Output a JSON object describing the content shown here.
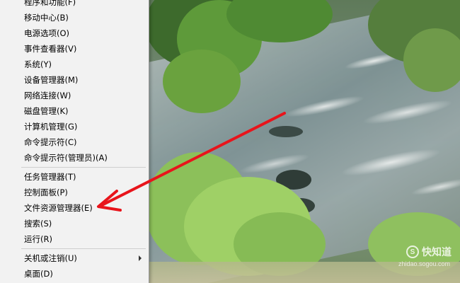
{
  "menu": {
    "items": [
      {
        "label": "程序和功能(F)"
      },
      {
        "label": "移动中心(B)"
      },
      {
        "label": "电源选项(O)"
      },
      {
        "label": "事件查看器(V)"
      },
      {
        "label": "系统(Y)"
      },
      {
        "label": "设备管理器(M)"
      },
      {
        "label": "网络连接(W)"
      },
      {
        "label": "磁盘管理(K)"
      },
      {
        "label": "计算机管理(G)"
      },
      {
        "label": "命令提示符(C)"
      },
      {
        "label": "命令提示符(管理员)(A)"
      },
      {
        "label": "任务管理器(T)"
      },
      {
        "label": "控制面板(P)"
      },
      {
        "label": "文件资源管理器(E)"
      },
      {
        "label": "搜索(S)"
      },
      {
        "label": "运行(R)"
      },
      {
        "label": "关机或注销(U)"
      },
      {
        "label": "桌面(D)"
      }
    ]
  },
  "watermark": {
    "brand": "快知道",
    "site": "zhidao.sogou.com"
  },
  "annotation": {
    "color": "#e8141b",
    "target": "文件资源管理器(E)"
  }
}
